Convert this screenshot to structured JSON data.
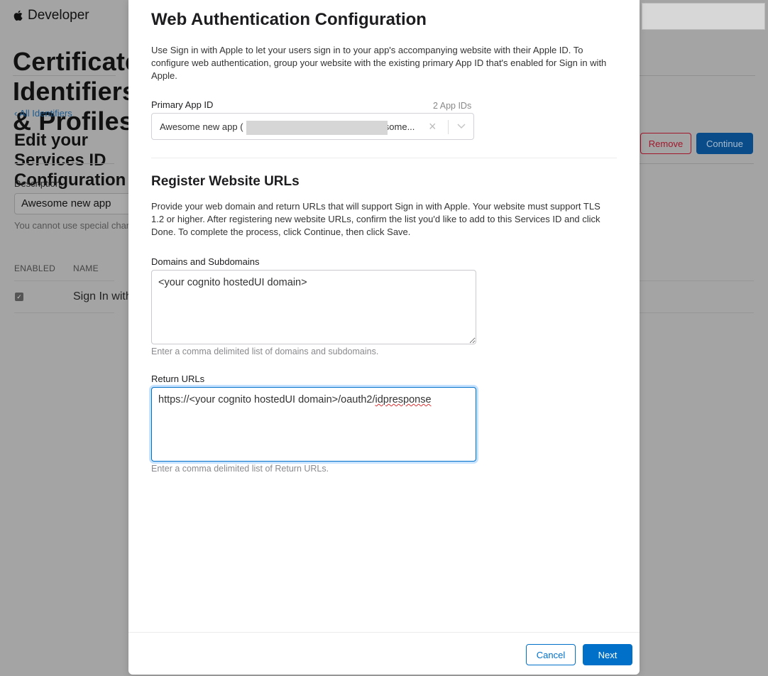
{
  "background": {
    "brand": "Developer",
    "page_title": "Certificates, Identifiers & Profiles",
    "back_link": "‹ All Identifiers",
    "edit_title": "Edit your Services ID Configuration",
    "remove_label": "Remove",
    "continue_label": "Continue",
    "description_label": "Description",
    "description_value": "Awesome new app",
    "description_help": "You cannot use special characters such as @, &, *, ', \"",
    "columns": {
      "enabled": "ENABLED",
      "name": "NAME"
    },
    "capabilities": [
      {
        "enabled": true,
        "name": "Sign In with Apple"
      }
    ]
  },
  "modal": {
    "title": "Web Authentication Configuration",
    "intro": "Use Sign in with Apple to let your users sign in to your app's accompanying website with their Apple ID. To configure web authentication, group your website with the existing primary App ID that's enabled for Sign in with Apple.",
    "primary_app_id": {
      "label": "Primary App ID",
      "count": "2 App IDs",
      "selected_prefix": "Awesome new app (",
      "selected_suffix": "esome...",
      "clear_icon": "×"
    },
    "register": {
      "heading": "Register Website URLs",
      "description": "Provide your web domain and return URLs that will support Sign in with Apple. Your website must support TLS 1.2 or higher. After registering new website URLs, confirm the list you'd like to add to this Services ID and click Done. To complete the process, click Continue, then click Save."
    },
    "domains": {
      "label": "Domains and Subdomains",
      "value": "<your cognito hostedUI domain>",
      "help": "Enter a comma delimited list of domains and subdomains."
    },
    "return_urls": {
      "label": "Return URLs",
      "value_prefix": "https://<your cognito hostedUI domain>/oauth2/",
      "value_misspelled": "idpresponse",
      "help": "Enter a comma delimited list of Return URLs."
    },
    "footer": {
      "cancel_label": "Cancel",
      "next_label": "Next"
    }
  }
}
